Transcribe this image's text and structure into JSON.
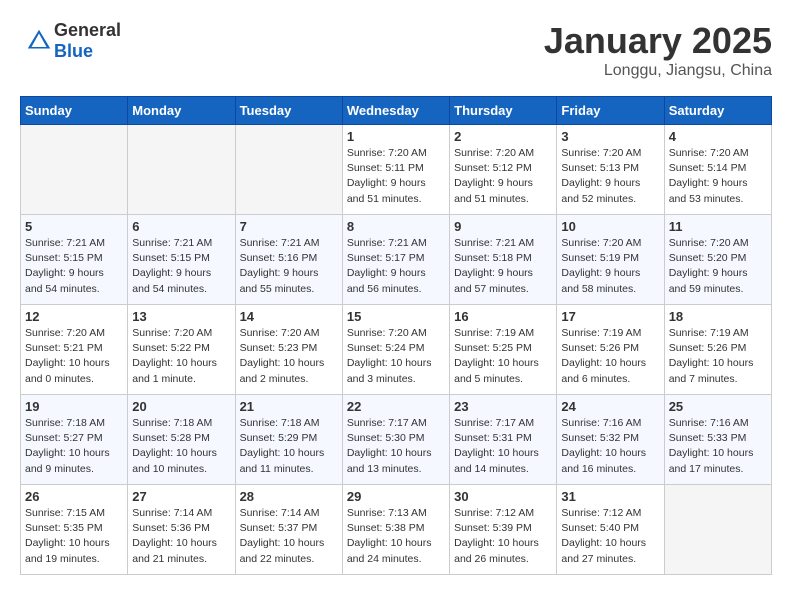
{
  "header": {
    "logo_general": "General",
    "logo_blue": "Blue",
    "month": "January 2025",
    "location": "Longgu, Jiangsu, China"
  },
  "weekdays": [
    "Sunday",
    "Monday",
    "Tuesday",
    "Wednesday",
    "Thursday",
    "Friday",
    "Saturday"
  ],
  "weeks": [
    [
      {
        "day": "",
        "empty": true
      },
      {
        "day": "",
        "empty": true
      },
      {
        "day": "",
        "empty": true
      },
      {
        "day": "1",
        "sunrise": "Sunrise: 7:20 AM",
        "sunset": "Sunset: 5:11 PM",
        "daylight": "Daylight: 9 hours and 51 minutes."
      },
      {
        "day": "2",
        "sunrise": "Sunrise: 7:20 AM",
        "sunset": "Sunset: 5:12 PM",
        "daylight": "Daylight: 9 hours and 51 minutes."
      },
      {
        "day": "3",
        "sunrise": "Sunrise: 7:20 AM",
        "sunset": "Sunset: 5:13 PM",
        "daylight": "Daylight: 9 hours and 52 minutes."
      },
      {
        "day": "4",
        "sunrise": "Sunrise: 7:20 AM",
        "sunset": "Sunset: 5:14 PM",
        "daylight": "Daylight: 9 hours and 53 minutes."
      }
    ],
    [
      {
        "day": "5",
        "sunrise": "Sunrise: 7:21 AM",
        "sunset": "Sunset: 5:15 PM",
        "daylight": "Daylight: 9 hours and 54 minutes."
      },
      {
        "day": "6",
        "sunrise": "Sunrise: 7:21 AM",
        "sunset": "Sunset: 5:15 PM",
        "daylight": "Daylight: 9 hours and 54 minutes."
      },
      {
        "day": "7",
        "sunrise": "Sunrise: 7:21 AM",
        "sunset": "Sunset: 5:16 PM",
        "daylight": "Daylight: 9 hours and 55 minutes."
      },
      {
        "day": "8",
        "sunrise": "Sunrise: 7:21 AM",
        "sunset": "Sunset: 5:17 PM",
        "daylight": "Daylight: 9 hours and 56 minutes."
      },
      {
        "day": "9",
        "sunrise": "Sunrise: 7:21 AM",
        "sunset": "Sunset: 5:18 PM",
        "daylight": "Daylight: 9 hours and 57 minutes."
      },
      {
        "day": "10",
        "sunrise": "Sunrise: 7:20 AM",
        "sunset": "Sunset: 5:19 PM",
        "daylight": "Daylight: 9 hours and 58 minutes."
      },
      {
        "day": "11",
        "sunrise": "Sunrise: 7:20 AM",
        "sunset": "Sunset: 5:20 PM",
        "daylight": "Daylight: 9 hours and 59 minutes."
      }
    ],
    [
      {
        "day": "12",
        "sunrise": "Sunrise: 7:20 AM",
        "sunset": "Sunset: 5:21 PM",
        "daylight": "Daylight: 10 hours and 0 minutes."
      },
      {
        "day": "13",
        "sunrise": "Sunrise: 7:20 AM",
        "sunset": "Sunset: 5:22 PM",
        "daylight": "Daylight: 10 hours and 1 minute."
      },
      {
        "day": "14",
        "sunrise": "Sunrise: 7:20 AM",
        "sunset": "Sunset: 5:23 PM",
        "daylight": "Daylight: 10 hours and 2 minutes."
      },
      {
        "day": "15",
        "sunrise": "Sunrise: 7:20 AM",
        "sunset": "Sunset: 5:24 PM",
        "daylight": "Daylight: 10 hours and 3 minutes."
      },
      {
        "day": "16",
        "sunrise": "Sunrise: 7:19 AM",
        "sunset": "Sunset: 5:25 PM",
        "daylight": "Daylight: 10 hours and 5 minutes."
      },
      {
        "day": "17",
        "sunrise": "Sunrise: 7:19 AM",
        "sunset": "Sunset: 5:26 PM",
        "daylight": "Daylight: 10 hours and 6 minutes."
      },
      {
        "day": "18",
        "sunrise": "Sunrise: 7:19 AM",
        "sunset": "Sunset: 5:26 PM",
        "daylight": "Daylight: 10 hours and 7 minutes."
      }
    ],
    [
      {
        "day": "19",
        "sunrise": "Sunrise: 7:18 AM",
        "sunset": "Sunset: 5:27 PM",
        "daylight": "Daylight: 10 hours and 9 minutes."
      },
      {
        "day": "20",
        "sunrise": "Sunrise: 7:18 AM",
        "sunset": "Sunset: 5:28 PM",
        "daylight": "Daylight: 10 hours and 10 minutes."
      },
      {
        "day": "21",
        "sunrise": "Sunrise: 7:18 AM",
        "sunset": "Sunset: 5:29 PM",
        "daylight": "Daylight: 10 hours and 11 minutes."
      },
      {
        "day": "22",
        "sunrise": "Sunrise: 7:17 AM",
        "sunset": "Sunset: 5:30 PM",
        "daylight": "Daylight: 10 hours and 13 minutes."
      },
      {
        "day": "23",
        "sunrise": "Sunrise: 7:17 AM",
        "sunset": "Sunset: 5:31 PM",
        "daylight": "Daylight: 10 hours and 14 minutes."
      },
      {
        "day": "24",
        "sunrise": "Sunrise: 7:16 AM",
        "sunset": "Sunset: 5:32 PM",
        "daylight": "Daylight: 10 hours and 16 minutes."
      },
      {
        "day": "25",
        "sunrise": "Sunrise: 7:16 AM",
        "sunset": "Sunset: 5:33 PM",
        "daylight": "Daylight: 10 hours and 17 minutes."
      }
    ],
    [
      {
        "day": "26",
        "sunrise": "Sunrise: 7:15 AM",
        "sunset": "Sunset: 5:35 PM",
        "daylight": "Daylight: 10 hours and 19 minutes."
      },
      {
        "day": "27",
        "sunrise": "Sunrise: 7:14 AM",
        "sunset": "Sunset: 5:36 PM",
        "daylight": "Daylight: 10 hours and 21 minutes."
      },
      {
        "day": "28",
        "sunrise": "Sunrise: 7:14 AM",
        "sunset": "Sunset: 5:37 PM",
        "daylight": "Daylight: 10 hours and 22 minutes."
      },
      {
        "day": "29",
        "sunrise": "Sunrise: 7:13 AM",
        "sunset": "Sunset: 5:38 PM",
        "daylight": "Daylight: 10 hours and 24 minutes."
      },
      {
        "day": "30",
        "sunrise": "Sunrise: 7:12 AM",
        "sunset": "Sunset: 5:39 PM",
        "daylight": "Daylight: 10 hours and 26 minutes."
      },
      {
        "day": "31",
        "sunrise": "Sunrise: 7:12 AM",
        "sunset": "Sunset: 5:40 PM",
        "daylight": "Daylight: 10 hours and 27 minutes."
      },
      {
        "day": "",
        "empty": true
      }
    ]
  ]
}
